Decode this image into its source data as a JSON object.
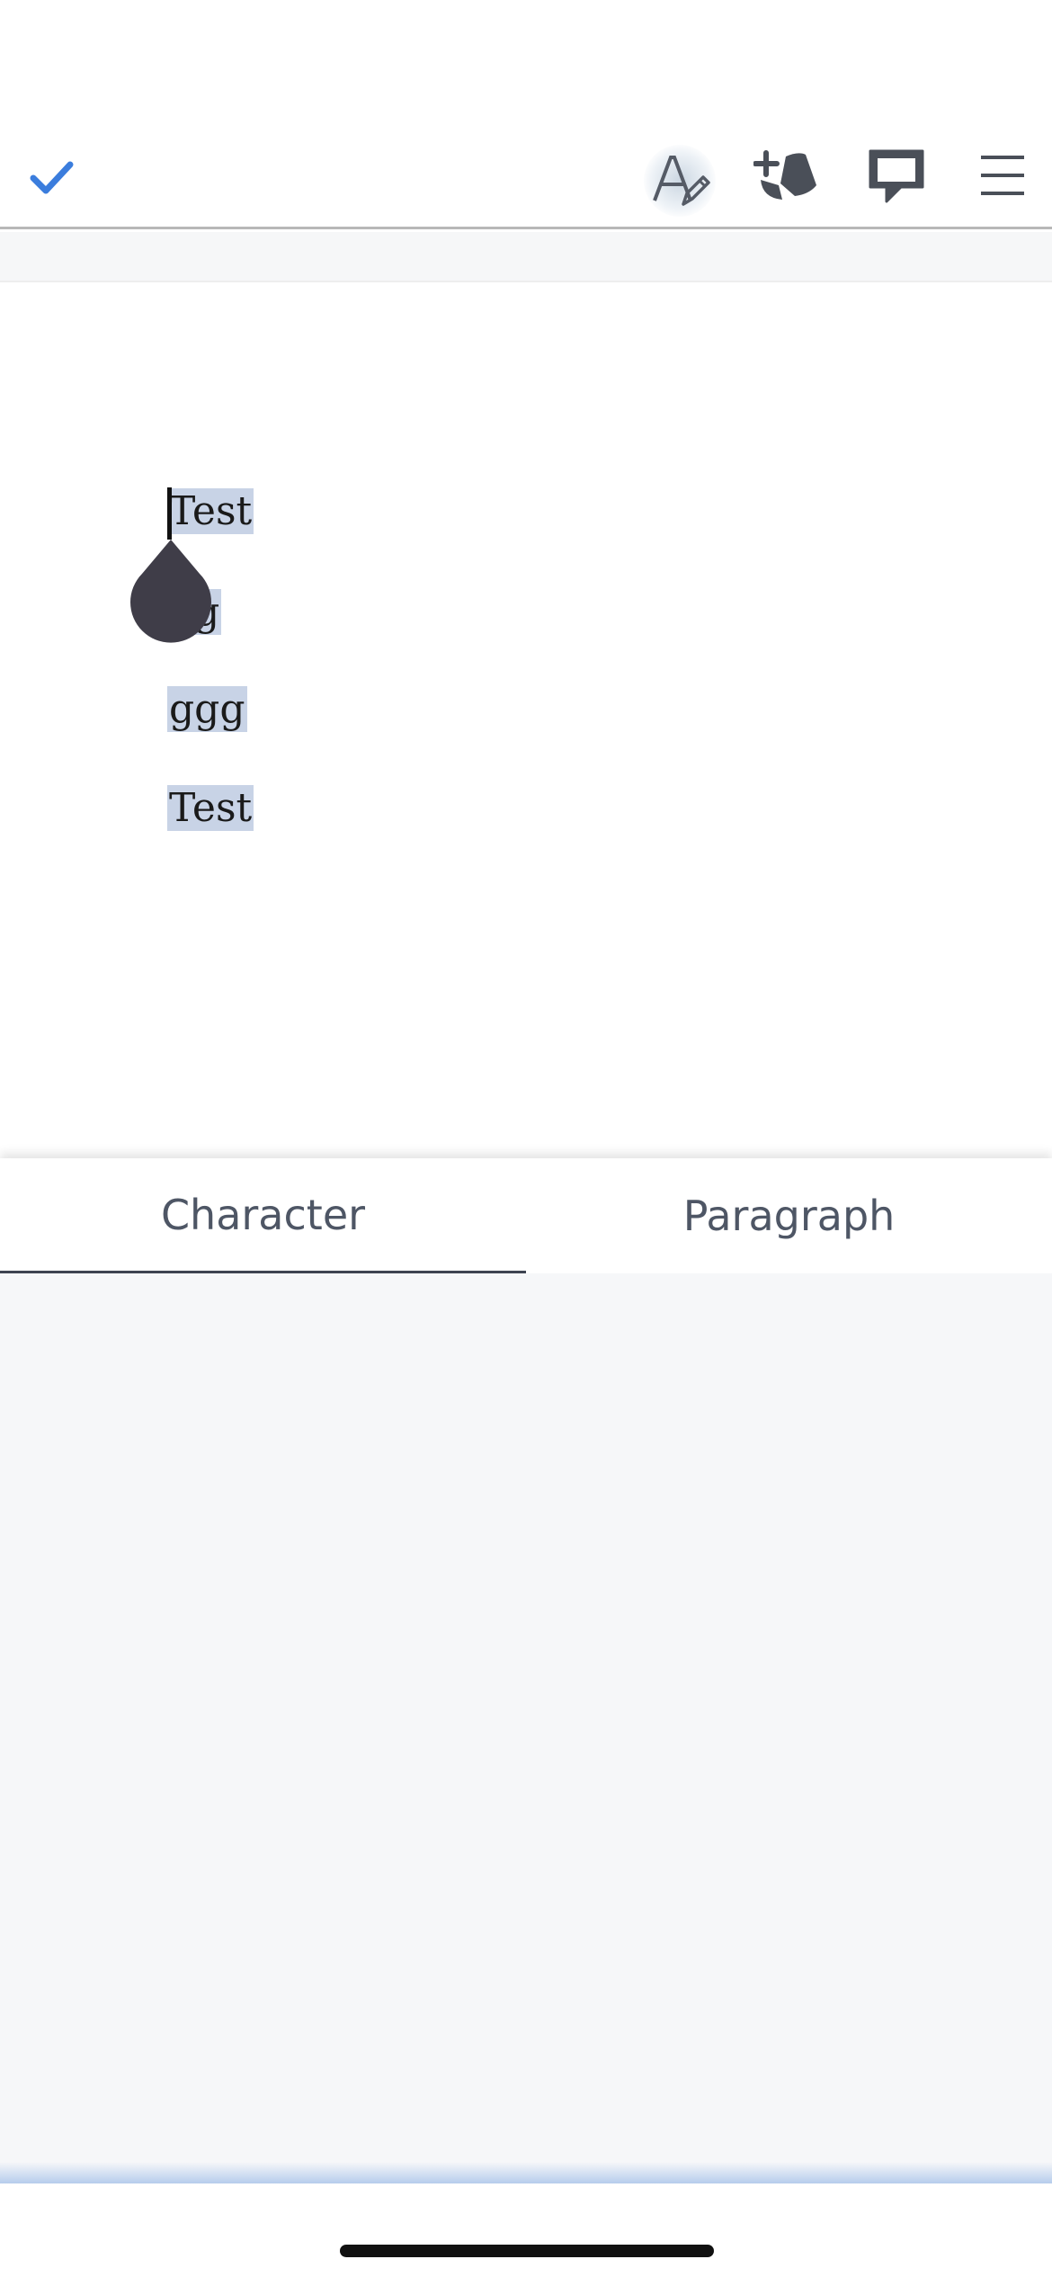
{
  "toolbar": {
    "done_icon": "checkmark-icon",
    "format_icon": "text-format-icon",
    "insert_icon": "insert-shapes-icon",
    "comment_icon": "comment-icon",
    "menu_icon": "hamburger-menu-icon",
    "accent_color": "#3b7ddd"
  },
  "document": {
    "lines": [
      "Test",
      "gg",
      "ggg",
      "Test"
    ],
    "selection_color": "#c8d3e6"
  },
  "panel": {
    "tabs": [
      {
        "label": "Character",
        "active": true
      },
      {
        "label": "Paragraph",
        "active": false
      }
    ]
  }
}
